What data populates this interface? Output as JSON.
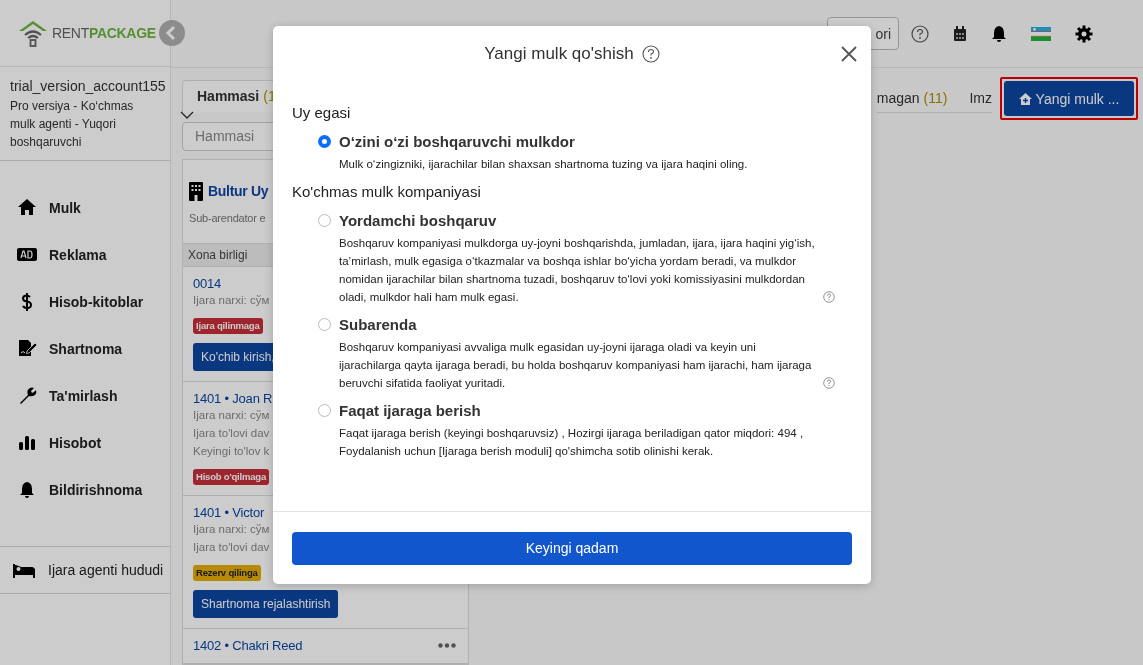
{
  "brand": {
    "prefix": "RENT",
    "suffix": "PACKAGE"
  },
  "account": {
    "name": "trial_version_account155",
    "plan": "Pro versiya - Ko‘chmas mulk agenti - Yuqori boshqaruvchi"
  },
  "nav": [
    {
      "label": "Mulk"
    },
    {
      "label": "Reklama"
    },
    {
      "label": "Hisob-kitoblar"
    },
    {
      "label": "Shartnoma"
    },
    {
      "label": "Ta'mirlash"
    },
    {
      "label": "Hisobot"
    },
    {
      "label": "Bildirishnoma"
    }
  ],
  "nav_bottom": {
    "label": "Ijara agenti hududi"
  },
  "topbar": {
    "button": "ori"
  },
  "filter_tab": {
    "label": "Hammasi",
    "count": "(1"
  },
  "filter_field": {
    "placeholder": "Hammasi"
  },
  "property": {
    "name": "Bultur Uy",
    "subtitle": "Sub-arendator e",
    "column": "Xona birligi"
  },
  "units": [
    {
      "title": "0014",
      "lines": [
        "Ijara narxi: сўм"
      ],
      "badge": {
        "text": "Ijara qilinmaga",
        "kind": "danger"
      },
      "button": "Ko'chib kirish,"
    },
    {
      "title": "1401 • Joan R",
      "lines": [
        "Ijara narxi: сўм",
        "Ijara to'lovi dav",
        "Keyingi to'lov k"
      ],
      "badge": {
        "text": "Hisob o'qilmaga",
        "kind": "danger"
      }
    },
    {
      "title": "1401 • Victor",
      "lines": [
        "Ijara narxi: сўм",
        "Ijara to'lovi dav"
      ],
      "badge": {
        "text": "Rezerv qilinga",
        "kind": "warning"
      },
      "button": "Shartnoma rejalashtirish"
    },
    {
      "title": "1402 • Chakri Reed",
      "menu": true
    }
  ],
  "status_tabs": [
    {
      "label": "magan",
      "count": "(11)"
    },
    {
      "label": "Imz"
    }
  ],
  "new_button": {
    "label": "Yangi mulk ...",
    "highlighted": true
  },
  "modal": {
    "title": "Yangi mulk qo'shish",
    "groups": [
      {
        "heading": "Uy egasi",
        "options": [
          {
            "label": "O‘zini o‘zi boshqaruvchi mulkdor",
            "description": "Mulk o‘zingizniki, ijarachilar bilan shaxsan shartnoma tuzing va ijara haqini oling.",
            "help": false,
            "selected": true
          }
        ]
      },
      {
        "heading": "Ko'chmas mulk kompaniyasi",
        "options": [
          {
            "label": "Yordamchi boshqaruv",
            "description": "Boshqaruv kompaniyasi mulkdorga uy-joyni boshqarishda, jumladan, ijara, ijara haqini yig‘ish, ta’mirlash, mulk egasiga o‘tkazmalar va boshqa ishlar bo‘yicha yordam beradi, va mulkdor nomidan ijarachilar bilan shartnoma tuzadi, boshqaruv to‘lovi yoki komissiyasini mulkdordan oladi, mulkdor hali ham mulk egasi.",
            "help": true,
            "selected": false
          },
          {
            "label": "Subarenda",
            "description": "Boshqaruv kompaniyasi avvaliga mulk egasidan uy-joyni ijaraga oladi va keyin uni ijarachilarga qayta ijaraga beradi, bu holda boshqaruv kompaniyasi ham ijarachi, ham ijaraga beruvchi sifatida faoliyat yuritadi.",
            "help": true,
            "selected": false
          },
          {
            "label": "Faqat ijaraga berish",
            "description": "Faqat ijaraga berish (keyingi boshqaruvsiz) , Hozirgi ijaraga beriladigan qator miqdori: 494 , Foydalanish uchun [Ijaraga berish moduli] qo'shimcha sotib olinishi kerak.",
            "help": false,
            "selected": false
          }
        ]
      }
    ],
    "next_button": "Keyingi qadam"
  }
}
